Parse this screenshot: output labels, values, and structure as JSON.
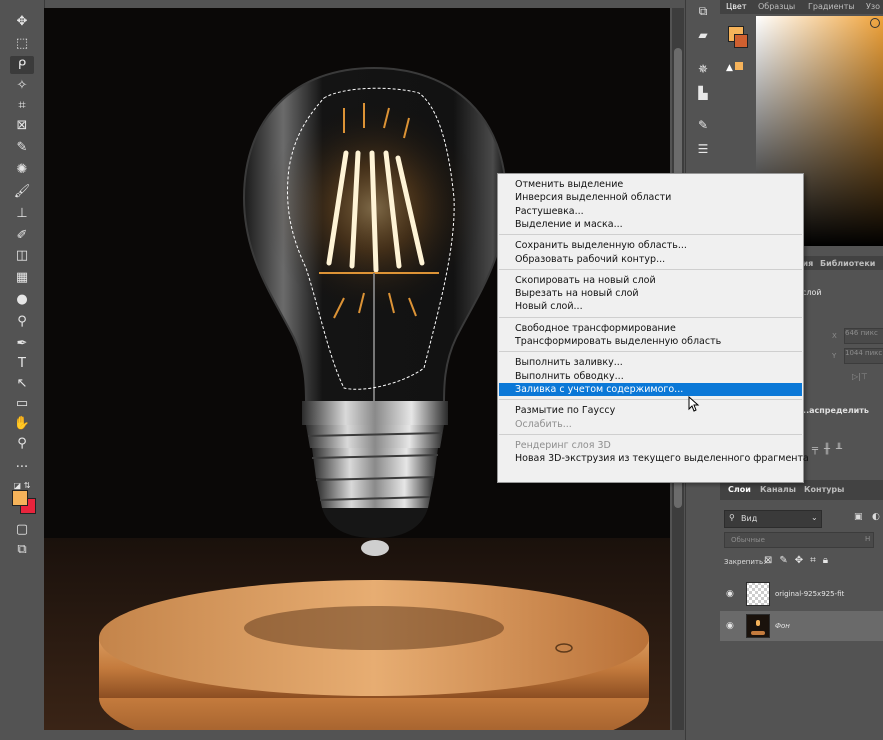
{
  "toolbar": {
    "tools": [
      {
        "icon": "move-icon",
        "glyph": "✥"
      },
      {
        "icon": "marquee-icon",
        "glyph": "⬚"
      },
      {
        "icon": "lasso-icon",
        "glyph": "ᑭ"
      },
      {
        "icon": "magic-wand-icon",
        "glyph": "✧"
      },
      {
        "icon": "crop-icon",
        "glyph": "⌗"
      },
      {
        "icon": "frame-icon",
        "glyph": "⊠"
      },
      {
        "icon": "eyedropper-icon",
        "glyph": "✎"
      },
      {
        "icon": "healing-brush-icon",
        "glyph": "✺"
      },
      {
        "icon": "brush-icon",
        "glyph": "🖌"
      },
      {
        "icon": "stamp-icon",
        "glyph": "⊥"
      },
      {
        "icon": "history-brush-icon",
        "glyph": "✐"
      },
      {
        "icon": "eraser-icon",
        "glyph": "◫"
      },
      {
        "icon": "gradient-icon",
        "glyph": "▦"
      },
      {
        "icon": "blur-icon",
        "glyph": "●"
      },
      {
        "icon": "dodge-icon",
        "glyph": "⚲"
      },
      {
        "icon": "pen-icon",
        "glyph": "✒"
      },
      {
        "icon": "type-icon",
        "glyph": "T"
      },
      {
        "icon": "path-select-icon",
        "glyph": "↖"
      },
      {
        "icon": "rectangle-icon",
        "glyph": "▭"
      },
      {
        "icon": "hand-icon",
        "glyph": "✋"
      },
      {
        "icon": "zoom-icon",
        "glyph": "⚲"
      },
      {
        "icon": "more-tools-icon",
        "glyph": "···"
      }
    ],
    "fg_color": "#f6b35a",
    "bg_color": "#e8243c"
  },
  "right_panel": {
    "top_tabs": [
      "Цвет",
      "Образцы",
      "Градиенты",
      "Узо"
    ],
    "properties_tabs": [
      "...кция",
      "Библиотеки"
    ],
    "properties_sub": "слой",
    "x_label": "X",
    "x_value": "646 пикс",
    "y_label": "Y",
    "y_value": "1044 пикс",
    "align_label": "...аспределить",
    "layers_tabs": [
      "Слои",
      "Каналы",
      "Контуры"
    ],
    "search_placeholder": "Вид",
    "blend_mode": "Обычные",
    "blend_opacity_label": "Н",
    "lock_label": "Закрепить:",
    "layers": [
      {
        "name": "original-925x925-fit",
        "visible": true,
        "selected": false
      },
      {
        "name": "Фон",
        "visible": true,
        "selected": true
      }
    ]
  },
  "context_menu": {
    "groups": [
      [
        {
          "label": "Отменить выделение",
          "disabled": false,
          "highlighted": false
        },
        {
          "label": "Инверсия выделенной области",
          "disabled": false,
          "highlighted": false
        },
        {
          "label": "Растушевка...",
          "disabled": false,
          "highlighted": false
        },
        {
          "label": "Выделение и маска...",
          "disabled": false,
          "highlighted": false
        }
      ],
      [
        {
          "label": "Сохранить выделенную область...",
          "disabled": false,
          "highlighted": false
        },
        {
          "label": "Образовать рабочий контур...",
          "disabled": false,
          "highlighted": false
        }
      ],
      [
        {
          "label": "Скопировать на новый слой",
          "disabled": false,
          "highlighted": false
        },
        {
          "label": "Вырезать на новый слой",
          "disabled": false,
          "highlighted": false
        },
        {
          "label": "Новый слой...",
          "disabled": false,
          "highlighted": false
        }
      ],
      [
        {
          "label": "Свободное трансформирование",
          "disabled": false,
          "highlighted": false
        },
        {
          "label": "Трансформировать выделенную область",
          "disabled": false,
          "highlighted": false
        }
      ],
      [
        {
          "label": "Выполнить заливку...",
          "disabled": false,
          "highlighted": false
        },
        {
          "label": "Выполнить обводку...",
          "disabled": false,
          "highlighted": false
        },
        {
          "label": "Заливка с учетом содержимого...",
          "disabled": false,
          "highlighted": true
        }
      ],
      [
        {
          "label": "Размытие по Гауссу",
          "disabled": false,
          "highlighted": false
        },
        {
          "label": "Ослабить...",
          "disabled": true,
          "highlighted": false
        }
      ],
      [
        {
          "label": "Рендеринг слоя 3D",
          "disabled": true,
          "highlighted": false
        },
        {
          "label": "Новая 3D-экструзия из текущего выделенного фрагмента",
          "disabled": false,
          "highlighted": false
        }
      ]
    ],
    "highlight_color": "#0b78d7"
  }
}
